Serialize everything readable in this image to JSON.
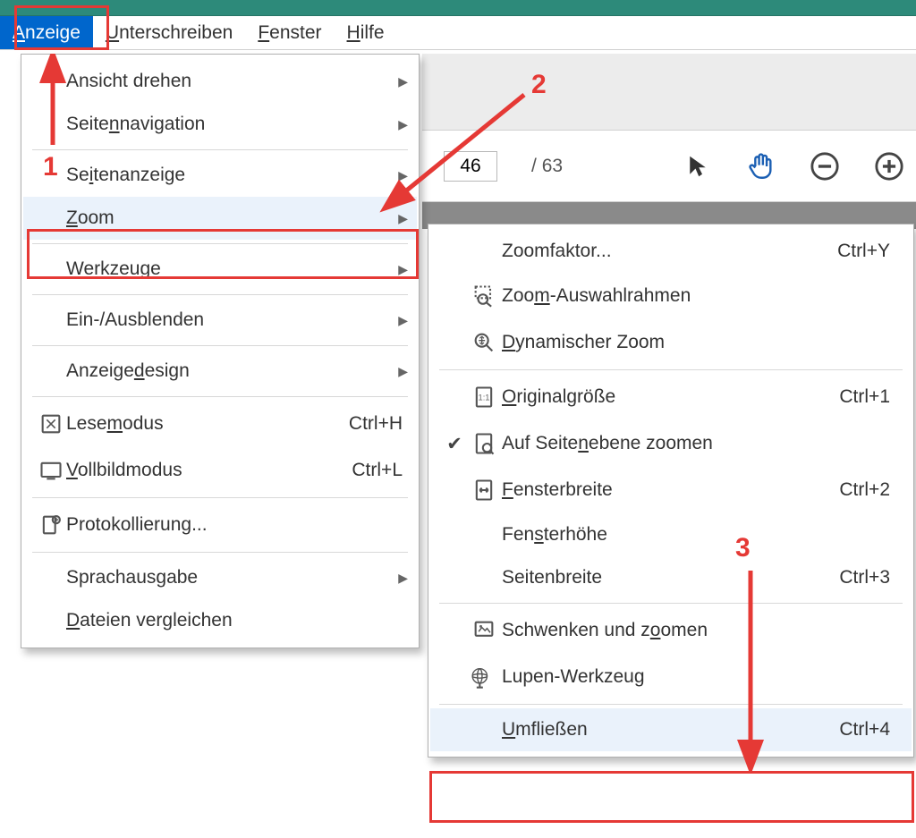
{
  "menubar": {
    "items": [
      {
        "label": "Anzeige",
        "accel": "A",
        "active": true
      },
      {
        "label": "Unterschreiben",
        "accel": "U"
      },
      {
        "label": "Fenster",
        "accel": "F"
      },
      {
        "label": "Hilfe",
        "accel": "H"
      }
    ]
  },
  "toolbar": {
    "page_current": "46",
    "page_sep": "/",
    "page_total": "63"
  },
  "dropdown": {
    "items": [
      {
        "label": "Ansicht drehen",
        "arrow": true
      },
      {
        "label": "Seitennavigation",
        "arrow": true,
        "u": "n",
        "sep_after": true
      },
      {
        "label": "Seitenanzeige",
        "arrow": true,
        "u": "i"
      },
      {
        "label": "Zoom",
        "arrow": true,
        "u": "Z",
        "hover": true,
        "sep_after": true
      },
      {
        "label": "Werkzeuge",
        "arrow": true,
        "u": "W",
        "sep_after": true
      },
      {
        "label": "Ein-/Ausblenden",
        "arrow": true,
        "sep_after": true
      },
      {
        "label": "Anzeigedesign",
        "arrow": true,
        "u": "d",
        "sep_after": true
      },
      {
        "label": "Lesemodus",
        "u": "m",
        "shortcut": "Ctrl+H",
        "icon": "reading"
      },
      {
        "label": "Vollbildmodus",
        "u": "V",
        "shortcut": "Ctrl+L",
        "icon": "fullscreen",
        "sep_after": true
      },
      {
        "label": "Protokollierung...",
        "icon": "log",
        "sep_after": true
      },
      {
        "label": "Sprachausgabe",
        "arrow": true
      },
      {
        "label": "Dateien vergleichen",
        "u": "D"
      }
    ]
  },
  "submenu": {
    "items": [
      {
        "label": "Zoomfaktor...",
        "shortcut": "Ctrl+Y"
      },
      {
        "label": "Zoom-Auswahlrahmen",
        "u": "m",
        "icon": "marquee"
      },
      {
        "label": "Dynamischer Zoom",
        "u": "D",
        "icon": "dynamic",
        "sep_after": true
      },
      {
        "label": "Originalgröße",
        "u": "O",
        "shortcut": "Ctrl+1",
        "icon": "actual"
      },
      {
        "label": "Auf Seitenebene zoomen",
        "u": "n",
        "icon": "fitpage",
        "checked": true
      },
      {
        "label": "Fensterbreite",
        "u": "F",
        "shortcut": "Ctrl+2",
        "icon": "fitwidth"
      },
      {
        "label": "Fensterhöhe",
        "u": "s"
      },
      {
        "label": "Seitenbreite",
        "u": "u",
        "shortcut": "Ctrl+3",
        "sep_after": true
      },
      {
        "label": "Schwenken und zoomen",
        "u": "o",
        "icon": "pan"
      },
      {
        "label": "Lupen-Werkzeug",
        "icon": "loupe",
        "sep_after": true
      },
      {
        "label": "Umfließen",
        "u": "U",
        "shortcut": "Ctrl+4",
        "hover": true
      }
    ]
  },
  "annotations": {
    "n1": "1",
    "n2": "2",
    "n3": "3"
  }
}
